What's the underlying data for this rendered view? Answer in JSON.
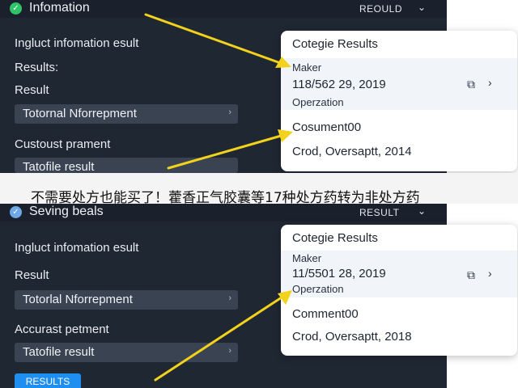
{
  "top": {
    "header": {
      "title": "Infomation",
      "right_label": "REOULD"
    },
    "labels": [
      "Ingluct infomation esult",
      "Results:",
      "Result"
    ],
    "field1": "Totornal Nforrepment",
    "label4": "Custoust prament",
    "field2": "Tatofile result",
    "card": {
      "heading": "Cotegie Results",
      "maker": "Maker",
      "date": "118/562 29, 2019",
      "sub": "Operzation",
      "comment": "Cosument00",
      "footer": "Crod, Oversaptt, 2014"
    }
  },
  "banner": {
    "text": "不需要处方也能买了！藿香正气胶囊等17种处方药转为非处方药"
  },
  "bottom": {
    "header": {
      "title": "Seving beals",
      "right_label": "RESULT"
    },
    "labels": [
      "Ingluct infomation esult",
      "Result"
    ],
    "field1": "Totorlal Nforrepment",
    "label3": "Accurast petment",
    "field2": "Tatofile result",
    "button": "RESULTS",
    "card": {
      "heading": "Cotegie Results",
      "maker": "Maker",
      "date": "11/5501 28, 2019",
      "sub": "Operzation",
      "comment": "Comment00",
      "footer": "Crod, Oversaptt, 2018"
    }
  },
  "colors": {
    "panel": "#1f2733",
    "field": "#3a4352",
    "arrow": "#f2d21b",
    "button": "#1e8ef0",
    "check": "#2fc46a"
  },
  "icons": {
    "header_top": "check-circle-icon",
    "header_bottom": "check-circle-icon",
    "dropdown": "chevron-down-icon",
    "copy": "copy-icon",
    "next": "chevron-right-icon"
  }
}
